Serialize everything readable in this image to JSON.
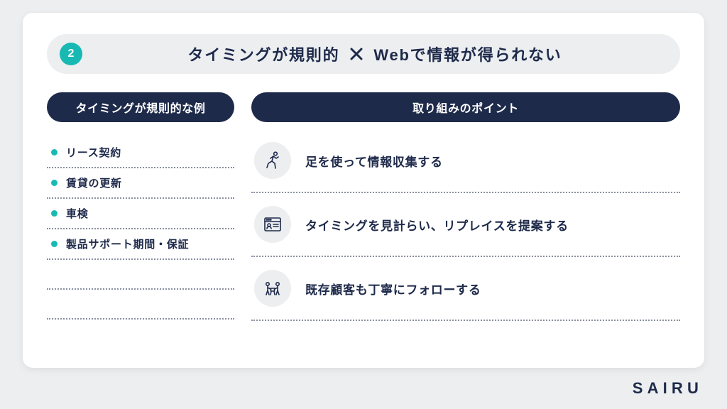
{
  "badge_number": "2",
  "title": {
    "left": "タイミングが規則的",
    "right": "Webで情報が得られない"
  },
  "left": {
    "header": "タイミングが規則的な例",
    "items": [
      "リース契約",
      "賃貸の更新",
      "車検",
      "製品サポート期間・保証"
    ]
  },
  "right": {
    "header": "取り組みのポイント",
    "points": [
      "足を使って情報収集する",
      "タイミングを見計らい、リプレイスを提案する",
      "既存顧客も丁寧にフォローする"
    ]
  },
  "brand": "SAIRU"
}
